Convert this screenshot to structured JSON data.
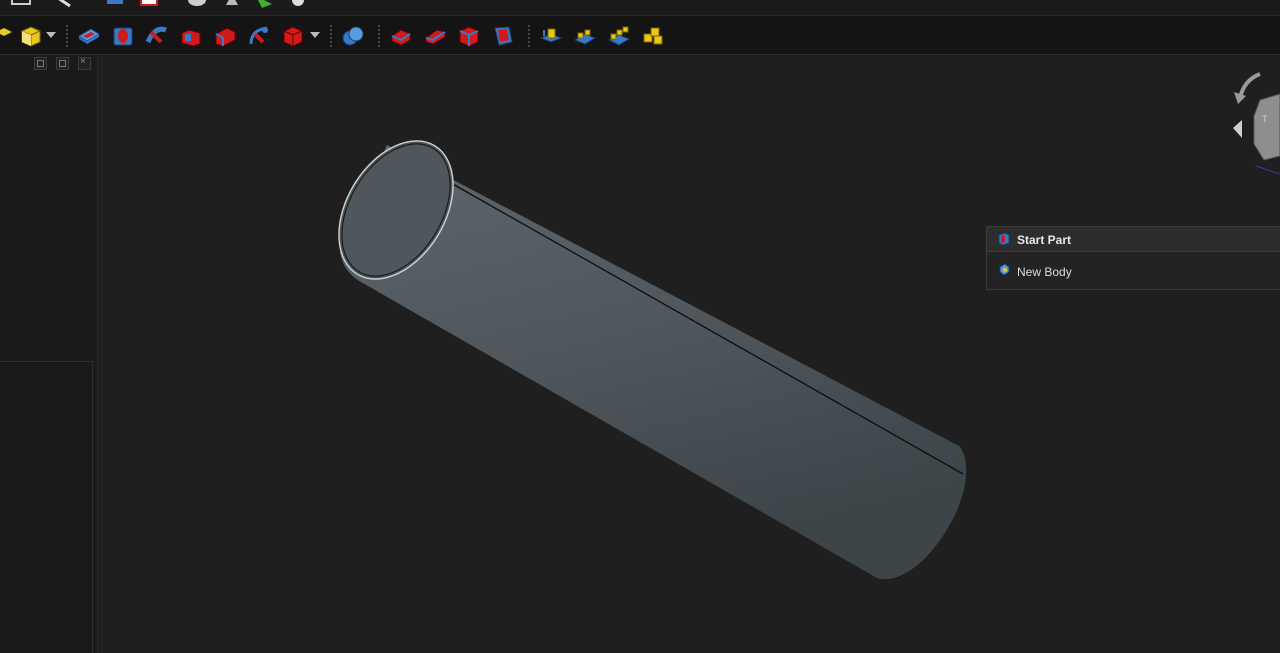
{
  "toolbar": {
    "icons": [
      "part-box-icon",
      "chamfer-icon",
      "pad-icon",
      "pocket-icon",
      "revolution-icon",
      "groove-icon",
      "loft-icon",
      "sweep-icon",
      "boolean-icon",
      "fillet-icon",
      "draft-icon",
      "thickness-icon",
      "edge-icon",
      "mirrored-icon",
      "linear-pattern-icon",
      "polar-pattern-icon",
      "multi-transform-icon"
    ]
  },
  "task_panel": {
    "title": "Start Part",
    "actions": [
      {
        "label": "New Body",
        "icon": "new-body-icon"
      }
    ]
  },
  "colors": {
    "background": "#1f1f1f",
    "tube_body": "#525a60",
    "edge": "#0a0a0a",
    "accent_red": "#d11b1b",
    "accent_blue": "#3a78c8",
    "accent_yellow": "#e8c81c"
  }
}
